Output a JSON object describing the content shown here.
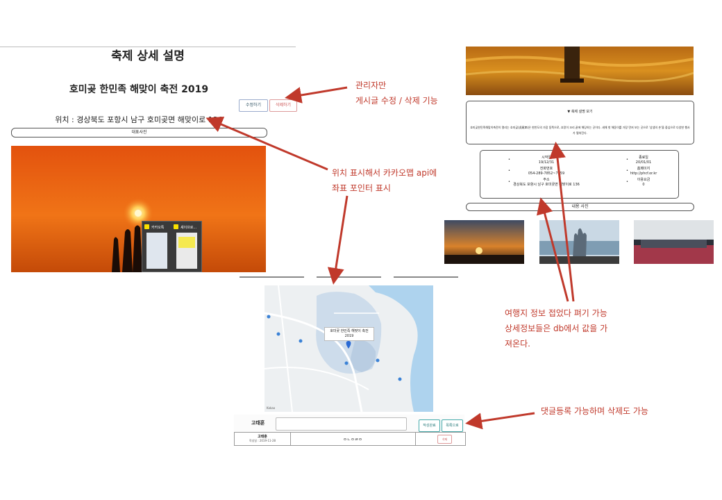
{
  "left": {
    "page_title": "축제 상세 설명",
    "festival_title": "호미곶 한민족 해맞이 축전 2019",
    "edit_label": "수정하기",
    "delete_label": "삭제하기",
    "location": "위치 : 경상북도 포항시 남구 호미곶면 해맞이로 136",
    "rep_photo_label": "대표사진",
    "popup": {
      "item1": "카카오톡",
      "item2": "셰이프로..."
    }
  },
  "annotations": {
    "admin_line1": "관리자만",
    "admin_line2": "게시글 수정 / 삭제 기능",
    "map_line1": "위치 표시해서 카카오맵 api에",
    "map_line2": "좌표 포인터 표시",
    "info_line1": "여행지 정보 접었다 펴기 가능",
    "info_line2": "상세정보들은 db에서 값을 가",
    "info_line3": "져온다.",
    "comment_note": "댓글등록 가능하며 삭제도 가능"
  },
  "map": {
    "label_line1": "호미곶 한민족 해맞이 축전",
    "label_line2": "2019",
    "credit": "Kakao"
  },
  "comment": {
    "author": "고태훈",
    "register_label": "작성완료",
    "list_label": "목록으로",
    "row_author": "고태훈",
    "row_date": "작성일 : 2019-11-28",
    "row_text": "ㅇㄴㅇㄹㅇ",
    "row_delete": "삭제"
  },
  "right": {
    "toggle_label": "▼ 축제 설명 보기",
    "description": "호미곶한민족해맞이축전이 열리는 호미곶(虎尾串)은 한반도의 가장 동쪽으로, 호랑이 꼬리 끝에 해당하는 곳이다. 새해 첫 해돋이를 가장 먼저 보는 곳으로 '상생의 손'을 중심으로 다양한 행사가 펼쳐진다.",
    "info": {
      "start_label": "시작일",
      "start_value": "19/12/31",
      "end_label": "종료일",
      "end_value": "20/01/01",
      "tel_label": "전화번호",
      "tel_value": "054-289-7852~7859",
      "home_label": "홈페이지",
      "home_value": "http://phcf.or.kr",
      "addr_label": "주소",
      "addr_value": "경상북도 포항시 남구 호미곶면 해맞이로 136",
      "fee_label": "이용요금",
      "fee_value": "0"
    },
    "detail_photos_label": "내용 사진"
  }
}
